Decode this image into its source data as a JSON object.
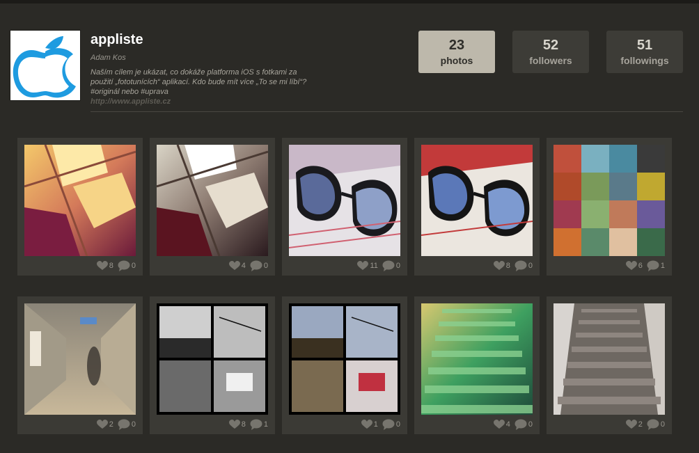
{
  "profile": {
    "username": "appliste",
    "real_name": "Adam Kos",
    "bio_lines": [
      "Naším cílem je ukázat, co dokáže platforma iOS s fotkami za",
      "použití „fototunících“ aplikací. Kdo bude mít více „To se mi líbí“?",
      "#originál nebo #uprava"
    ],
    "website": "http://www.appliste.cz"
  },
  "stats": [
    {
      "value": "23",
      "label": "photos"
    },
    {
      "value": "52",
      "label": "followers"
    },
    {
      "value": "51",
      "label": "followings"
    }
  ],
  "photos": [
    {
      "likes": "8",
      "comments": "0"
    },
    {
      "likes": "4",
      "comments": "0"
    },
    {
      "likes": "11",
      "comments": "0"
    },
    {
      "likes": "8",
      "comments": "0"
    },
    {
      "likes": "6",
      "comments": "1"
    },
    {
      "likes": "2",
      "comments": "0"
    },
    {
      "likes": "8",
      "comments": "1"
    },
    {
      "likes": "1",
      "comments": "0"
    },
    {
      "likes": "4",
      "comments": "0"
    },
    {
      "likes": "2",
      "comments": "0"
    }
  ],
  "colors": {
    "background": "#2b2a26",
    "card": "#3b3a35",
    "active_stat": "#bdb8ab",
    "apple_blue": "#1e9be0"
  }
}
